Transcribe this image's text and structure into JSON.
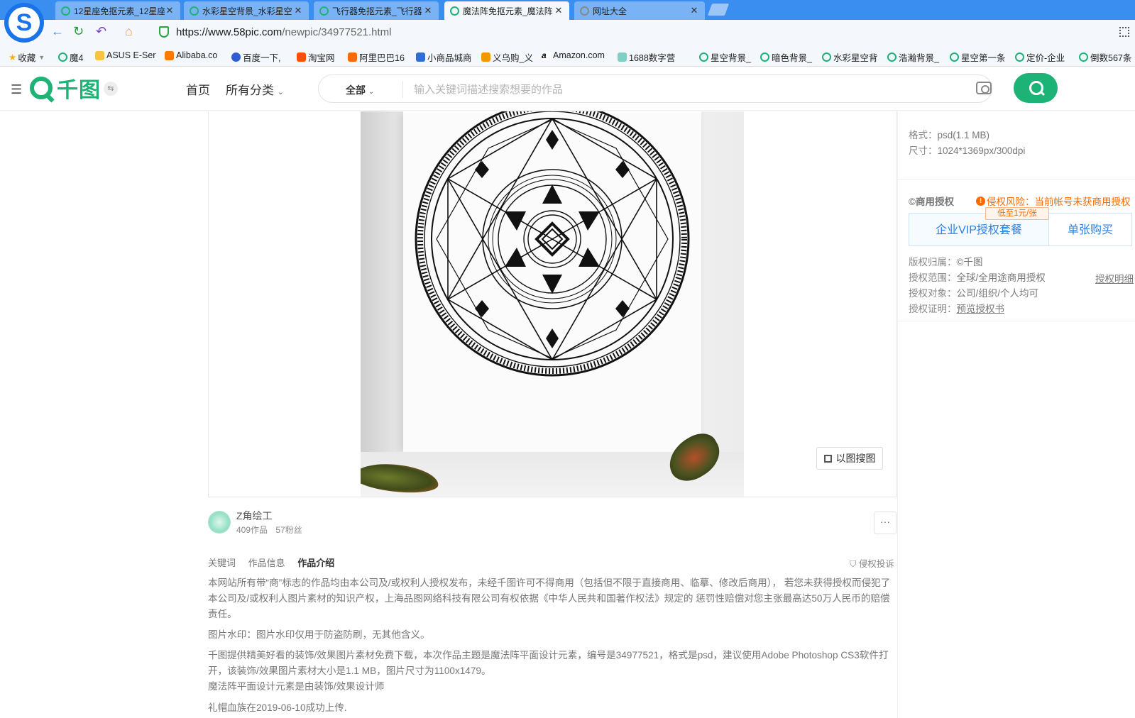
{
  "browser": {
    "tabs": [
      {
        "title": "12星座免抠元素_12星座",
        "active": false
      },
      {
        "title": "水彩星空背景_水彩星空",
        "active": false
      },
      {
        "title": "飞行器免抠元素_飞行器",
        "active": false
      },
      {
        "title": "魔法阵免抠元素_魔法阵",
        "active": true
      },
      {
        "title": "网址大全",
        "active": false
      }
    ],
    "url_host": "https://www.58pic.com",
    "url_path": "/newpic/34977521.html",
    "bookmarks": [
      "收藏",
      "魔4",
      "ASUS E-Ser",
      "Alibaba.co",
      "百度一下,",
      "淘宝网",
      "阿里巴巴16",
      "小商品城商",
      "义乌购_义",
      "Amazon.com",
      "1688数字营",
      "星空背景_",
      "暗色背景_",
      "水彩星空背",
      "浩瀚背景_",
      "星空第一条",
      "定价-企业",
      "倒数567条"
    ]
  },
  "header": {
    "logo_text": "千图",
    "nav_home": "首页",
    "nav_categories": "所有分类",
    "search_scope": "全部",
    "search_placeholder": "输入关键词描述搜索想要的作品"
  },
  "preview": {
    "image_search_label": "以图搜图"
  },
  "author": {
    "name": "Z角绘工",
    "works": "409作品",
    "fans": "57粉丝",
    "more_label": "···"
  },
  "info_tabs": [
    "关键词",
    "作品信息",
    "作品介绍"
  ],
  "report_label": "侵权投诉",
  "intro": {
    "p1": "本网站所有带“商”标志的作品均由本公司及/或权利人授权发布，未经千图许可不得商用（包括但不限于直接商用、临摹、修改后商用）， 若您未获得授权而侵犯了本公司及/或权利人图片素材的知识产权，上海品图网络科技有限公司有权依据《中华人民共和国著作权法》规定的 惩罚性赔偿对您主张最高达50万人民币的赔偿责任。",
    "p2": "图片水印：图片水印仅用于防盗防刷，无其他含义。",
    "p3a": "千图提供精美好看的装饰/效果图片素材免费下载，本次作品主题是魔法阵平面设计元素，编号是34977521，格式是psd，建议使用Adobe Photoshop CS3软件打开，该装饰/效果图片素材大小是1.1 MB，图片尺寸为1100x1479。",
    "p3b": "魔法阵平面设计元素是由装饰/效果设计师",
    "p4": "礼帽血族在2019-06-10成功上传."
  },
  "sidebar": {
    "format_label": "格式：",
    "format_value": "psd(1.1 MB)",
    "size_label": "尺寸：",
    "size_value": "1024*1369px/300dpi",
    "license_head": "©商用授权",
    "risk_text": "侵权风险：当前帐号未获商用授权",
    "price_tag": "低至1元/张",
    "vip_button": "企业VIP授权套餐",
    "single_button": "单张购买",
    "rows": [
      {
        "label": "版权归属：",
        "value": "©千图"
      },
      {
        "label": "授权范围：",
        "value": "全球/全用途商用授权"
      },
      {
        "label": "授权对象：",
        "value": "公司/组织/个人均可"
      },
      {
        "label": "授权证明：",
        "value": "预览授权书"
      }
    ],
    "detail_link": "授权明细"
  },
  "colors": {
    "brand_green": "#1db377",
    "tabbar_blue": "#3a8ef0",
    "risk_orange": "#ff6a00",
    "link_blue": "#2b7fe0"
  }
}
